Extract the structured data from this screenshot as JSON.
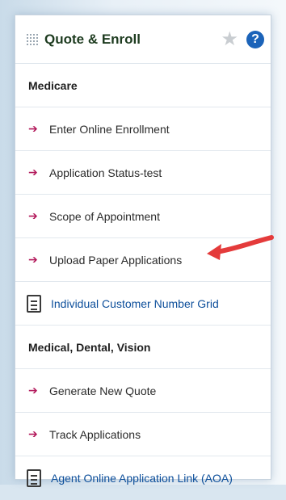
{
  "panel": {
    "title": "Quote & Enroll",
    "icons": {
      "star": "star-icon",
      "help": "?"
    }
  },
  "sections": [
    {
      "title": "Medicare",
      "items": [
        {
          "label": "Enter Online Enrollment"
        },
        {
          "label": "Application Status-test"
        },
        {
          "label": "Scope of Appointment"
        },
        {
          "label": "Upload Paper Applications"
        }
      ],
      "doc_link": "Individual Customer Number Grid"
    },
    {
      "title": "Medical, Dental, Vision",
      "items": [
        {
          "label": "Generate New Quote"
        },
        {
          "label": "Track Applications"
        }
      ],
      "doc_link": "Agent Online Application Link (AOA)"
    }
  ],
  "colors": {
    "arrow": "#b2185a",
    "link": "#0d4f9b",
    "help": "#1b63b9",
    "callout": "#e43b3b"
  }
}
